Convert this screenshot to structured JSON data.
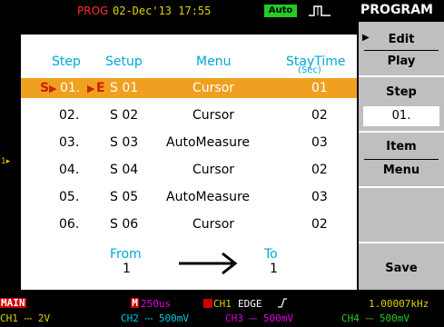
{
  "status": {
    "mode": "PROG",
    "datetime": "02-Dec'13 17:55",
    "acquire": "Auto",
    "title": "PROGRAM"
  },
  "table": {
    "headers": {
      "step": "Step",
      "setup": "Setup",
      "menu": "Menu",
      "staytime": "StayTime",
      "staytime_unit": "(Sec)"
    },
    "rows": [
      {
        "step": "01.",
        "setup": "S 01",
        "menu": "Cursor",
        "stay": "01",
        "start_marker": "S",
        "end_marker": "E"
      },
      {
        "step": "02.",
        "setup": "S 02",
        "menu": "Cursor",
        "stay": "02"
      },
      {
        "step": "03.",
        "setup": "S 03",
        "menu": "AutoMeasure",
        "stay": "03"
      },
      {
        "step": "04.",
        "setup": "S 04",
        "menu": "Cursor",
        "stay": "02"
      },
      {
        "step": "05.",
        "setup": "S 05",
        "menu": "AutoMeasure",
        "stay": "03"
      },
      {
        "step": "06.",
        "setup": "S 06",
        "menu": "Cursor",
        "stay": "02"
      }
    ],
    "from_label": "From",
    "from_value": "1",
    "to_label": "To",
    "to_value": "1"
  },
  "softkeys": {
    "edit": "Edit",
    "play": "Play",
    "step": "Step",
    "step_value": "01.",
    "item": "Item",
    "menu": "Menu",
    "save": "Save"
  },
  "bottom": {
    "main": "MAIN",
    "timebase": "250us",
    "trig_src": "CH1",
    "trig_type": "EDGE",
    "freq": "1.00007kHz",
    "ch1": "CH1 ⎓ 2V",
    "ch2": "CH2 ⎓ 500mV",
    "ch3": "CH3 ⎓ 500mV",
    "ch4": "CH4 ⎓ 500mV"
  },
  "colors": {
    "accent": "#00a8d8",
    "selected_row": "#f0a020",
    "softkey_bg": "#bfbfbf"
  }
}
